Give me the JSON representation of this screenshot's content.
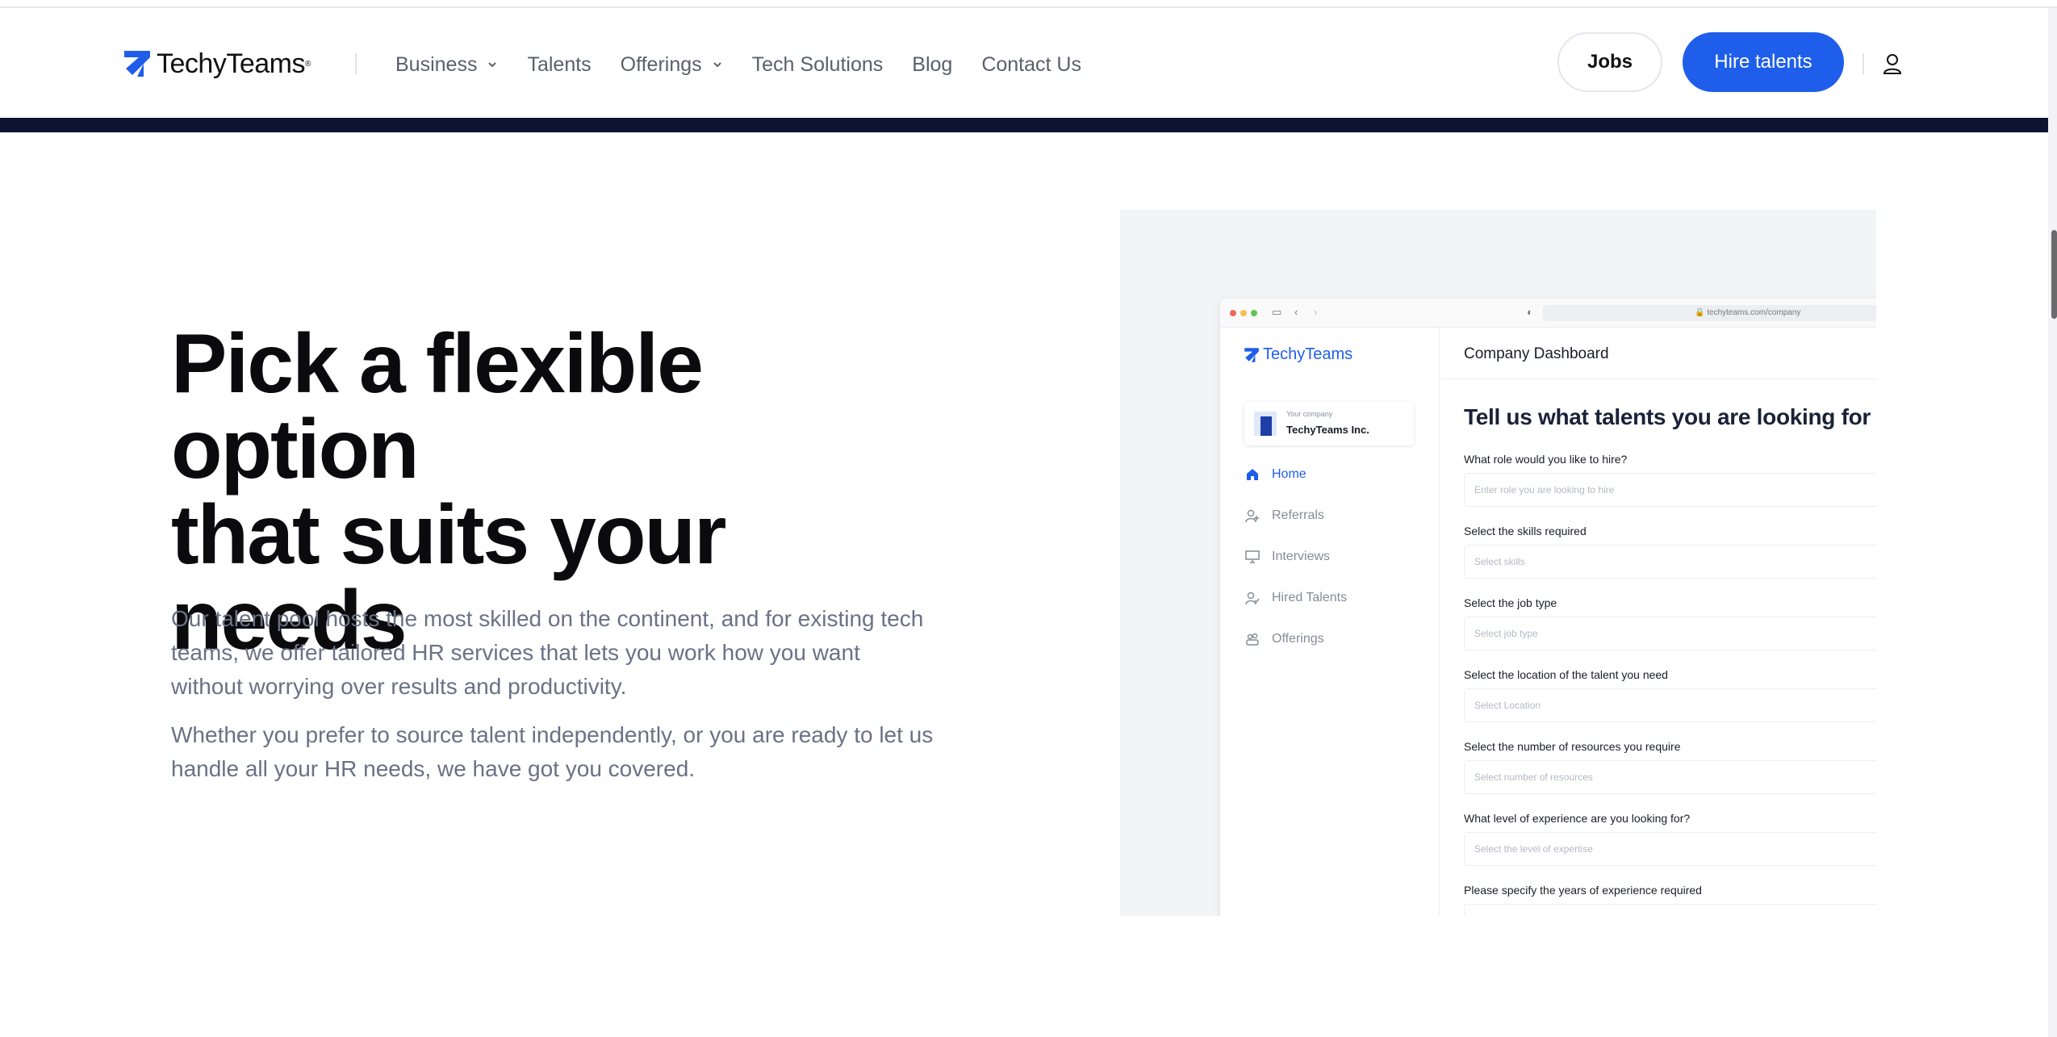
{
  "brand": {
    "name": "TechyTeams",
    "accent": "#1e5eea",
    "dark_bar": "#0c1430"
  },
  "nav": {
    "items": [
      {
        "label": "Business",
        "has_dropdown": true
      },
      {
        "label": "Talents",
        "has_dropdown": false
      },
      {
        "label": "Offerings",
        "has_dropdown": true
      },
      {
        "label": "Tech Solutions",
        "has_dropdown": false
      },
      {
        "label": "Blog",
        "has_dropdown": false
      },
      {
        "label": "Contact Us",
        "has_dropdown": false
      }
    ],
    "jobs_label": "Jobs",
    "hire_label": "Hire talents",
    "account_icon": "user-icon"
  },
  "hero": {
    "title_line1": "Pick a flexible option",
    "title_line2": "that suits your",
    "title_line3": "needs",
    "paragraph1": "Our talent pool hosts the most skilled on the continent, and for existing tech teams, we offer tailored HR services that lets you work how you want without worrying over results and productivity.",
    "paragraph2": "Whether you prefer to source talent independently, or you are ready to let us handle all your HR needs, we have got you covered."
  },
  "mockup": {
    "url": "techyteams.com/company",
    "sidebar": {
      "logo": "TechyTeams",
      "company_caption": "Your company",
      "company_name": "TechyTeams Inc.",
      "items": [
        {
          "label": "Home",
          "icon": "home-icon",
          "active": true
        },
        {
          "label": "Referrals",
          "icon": "user-plus-icon",
          "active": false
        },
        {
          "label": "Interviews",
          "icon": "monitor-icon",
          "active": false
        },
        {
          "label": "Hired Talents",
          "icon": "user-check-icon",
          "active": false
        },
        {
          "label": "Offerings",
          "icon": "group-icon",
          "active": false
        }
      ]
    },
    "header_title": "Company Dashboard",
    "form_title": "Tell us what talents you are looking for",
    "fields": [
      {
        "label": "What role would you like to hire?",
        "placeholder": "Enter role you are looking to hire"
      },
      {
        "label": "Select the skills required",
        "placeholder": "Select skills"
      },
      {
        "label": "Select the job type",
        "placeholder": "Select job type"
      },
      {
        "label": "Select the location of the talent you need",
        "placeholder": "Select Location"
      },
      {
        "label": "Select the number of resources you require",
        "placeholder": "Select number of resources"
      },
      {
        "label": "What level of experience are you looking for?",
        "placeholder": "Select the level of expertise"
      },
      {
        "label": "Please specify the years of experience required",
        "placeholder": ""
      }
    ]
  }
}
